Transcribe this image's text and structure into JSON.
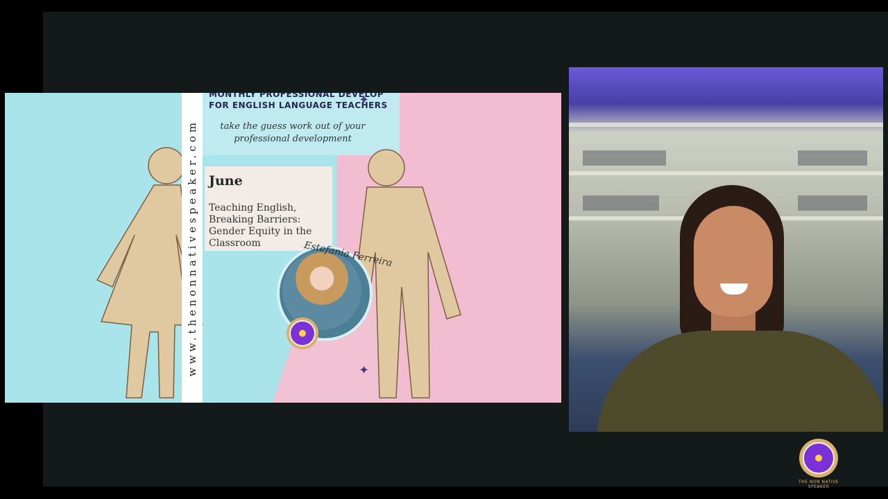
{
  "slide": {
    "website": "www.thenonnativespeaker.com",
    "header_line1": "Monthly Professional Develop",
    "header_line2": "for English Language Teachers",
    "tagline": "take the guess work out of your professional development",
    "month": "June",
    "talk_title": "Teaching English, Breaking Barriers: Gender Equity in the Classroom",
    "presenter_signature": "Estefania Ferreira",
    "badge_text": "THE NON NATIVE SPEAKER"
  },
  "colors": {
    "slide_blue": "#a9e4ea",
    "slide_pink": "#f2bdd0",
    "badge_purple": "#7a32d8",
    "badge_gold": "#d8b070"
  }
}
